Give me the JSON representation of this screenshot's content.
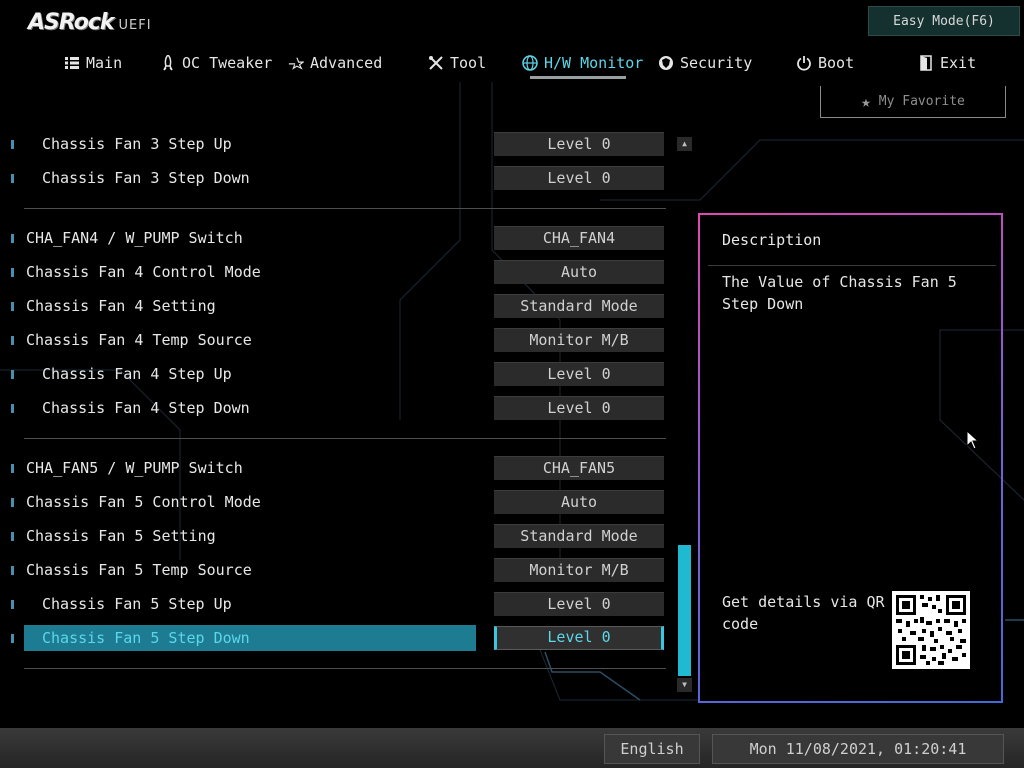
{
  "brand": {
    "logo_main": "ASRock",
    "logo_sub": "UEFI"
  },
  "easy_mode": "Easy Mode(F6)",
  "menu": [
    {
      "label": "Main",
      "icon": "list-icon"
    },
    {
      "label": "OC Tweaker",
      "icon": "rocket-icon"
    },
    {
      "label": "Advanced",
      "icon": "star-arrow-icon"
    },
    {
      "label": "Tool",
      "icon": "tools-icon"
    },
    {
      "label": "H/W Monitor",
      "icon": "globe-icon",
      "active": true
    },
    {
      "label": "Security",
      "icon": "shield-icon"
    },
    {
      "label": "Boot",
      "icon": "power-icon"
    },
    {
      "label": "Exit",
      "icon": "exit-door-icon"
    }
  ],
  "favorite": "My Favorite",
  "settings": [
    {
      "label": "Chassis Fan 3 Step Up",
      "value": "Level 0"
    },
    {
      "label": "Chassis Fan 3 Step Down",
      "value": "Level 0"
    },
    {
      "label": "CHA_FAN4 / W_PUMP Switch",
      "value": "CHA_FAN4"
    },
    {
      "label": "Chassis Fan 4 Control Mode",
      "value": "Auto"
    },
    {
      "label": "Chassis Fan 4 Setting",
      "value": "Standard Mode"
    },
    {
      "label": "Chassis Fan 4 Temp Source",
      "value": "Monitor M/B"
    },
    {
      "label": "Chassis Fan 4 Step Up",
      "value": "Level 0"
    },
    {
      "label": "Chassis Fan 4 Step Down",
      "value": "Level 0"
    },
    {
      "label": "CHA_FAN5 / W_PUMP Switch",
      "value": "CHA_FAN5"
    },
    {
      "label": "Chassis Fan 5 Control Mode",
      "value": "Auto"
    },
    {
      "label": "Chassis Fan 5 Setting",
      "value": "Standard Mode"
    },
    {
      "label": "Chassis Fan 5 Temp Source",
      "value": "Monitor M/B"
    },
    {
      "label": "Chassis Fan 5 Step Up",
      "value": "Level 0"
    },
    {
      "label": "Chassis Fan 5 Step Down",
      "value": "Level 0",
      "selected": true
    }
  ],
  "description": {
    "title": "Description",
    "text": "The Value of Chassis Fan 5 Step Down",
    "qr_text": "Get details via QR code"
  },
  "status": {
    "language": "English",
    "datetime": "Mon 11/08/2021, 01:20:41"
  },
  "colors": {
    "accent": "#5dd6ea",
    "highlight": "#1e7c92",
    "scroll_thumb": "#1fb9d2",
    "panel_border_start": "#e048b0",
    "panel_border_end": "#3f6cd8"
  }
}
